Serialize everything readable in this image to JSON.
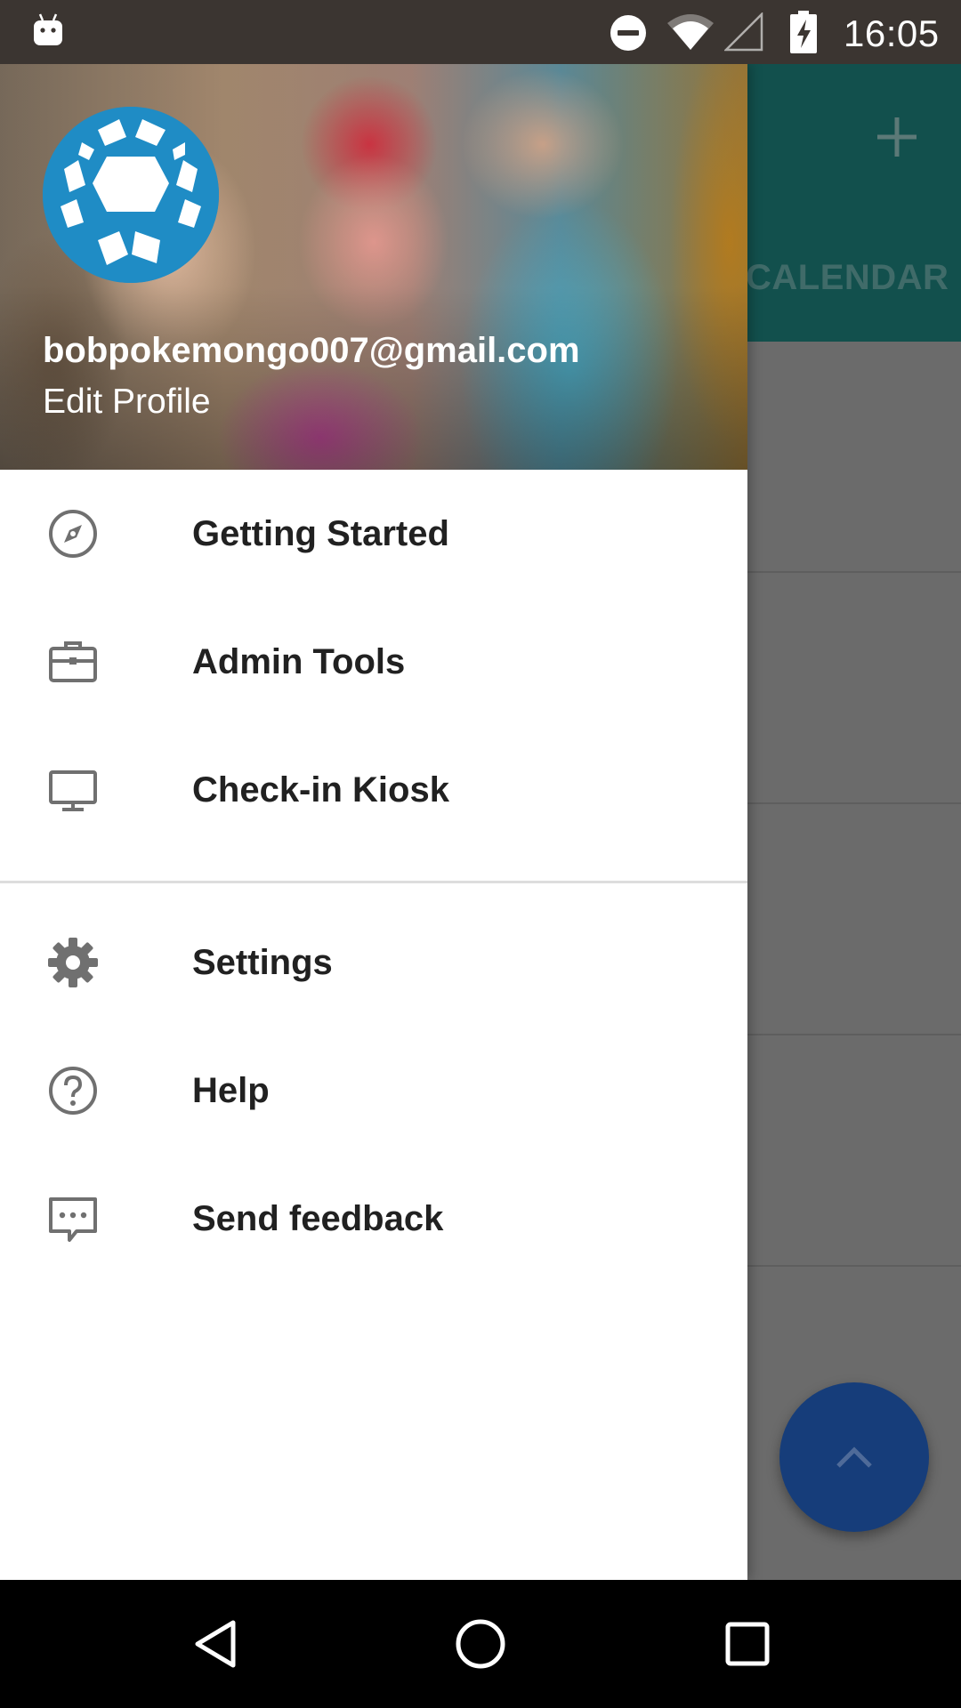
{
  "status_bar": {
    "time": "16:05",
    "icons": [
      "android-robot-icon",
      "do-not-disturb-icon",
      "wifi-icon",
      "cell-signal-icon",
      "battery-charging-icon"
    ]
  },
  "app": {
    "tab_label": "CALENDAR",
    "toolbar_color": "#1f8a85",
    "fab_color": "#163d7a",
    "actions": [
      "add-icon",
      "chevron-up-icon"
    ]
  },
  "drawer": {
    "account": {
      "email": "bobpokemongo007@gmail.com",
      "edit_label": "Edit Profile",
      "avatar_color": "#1f8cc5"
    },
    "items": [
      {
        "label": "Getting Started",
        "icon": "compass-icon"
      },
      {
        "label": "Admin Tools",
        "icon": "briefcase-icon"
      },
      {
        "label": "Check-in Kiosk",
        "icon": "monitor-icon"
      },
      {
        "label": "Settings",
        "icon": "gear-icon"
      },
      {
        "label": "Help",
        "icon": "help-circle-icon"
      },
      {
        "label": "Send feedback",
        "icon": "feedback-icon"
      }
    ]
  },
  "nav_bar": {
    "buttons": [
      "back-icon",
      "home-icon",
      "recents-icon"
    ]
  }
}
